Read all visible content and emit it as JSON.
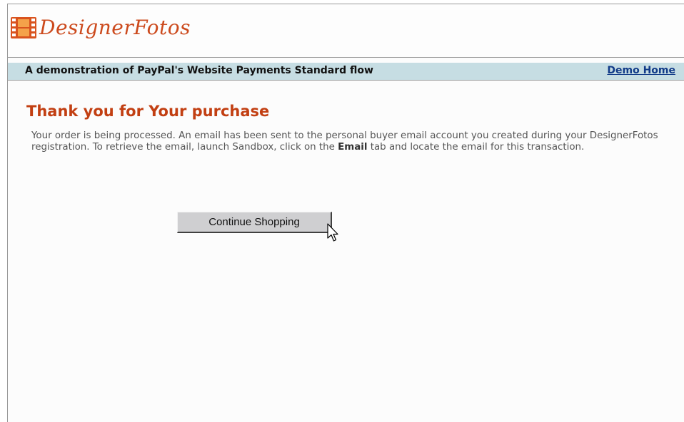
{
  "header": {
    "logo_text": "DesignerFotos"
  },
  "topbar": {
    "title": "A demonstration of PayPal's Website Payments Standard flow",
    "demo_home_link": "Demo Home"
  },
  "main": {
    "heading": "Thank you for Your purchase",
    "message_part1": "Your order is being processed. An email has been sent to the personal buyer email account you created during your DesignerFotos registration. To retrieve the email, launch Sandbox, click on the ",
    "message_bold": "Email",
    "message_part2": " tab and locate the email for this transaction.",
    "continue_button": "Continue Shopping"
  },
  "colors": {
    "brand": "#cc4a1d",
    "heading": "#c23f12",
    "topbar_bg": "#c6dde3",
    "link": "#123b88",
    "button_bg": "#cfcfd1"
  },
  "icons": {
    "logo": "film-strip-icon",
    "cursor": "mouse-pointer-icon"
  }
}
